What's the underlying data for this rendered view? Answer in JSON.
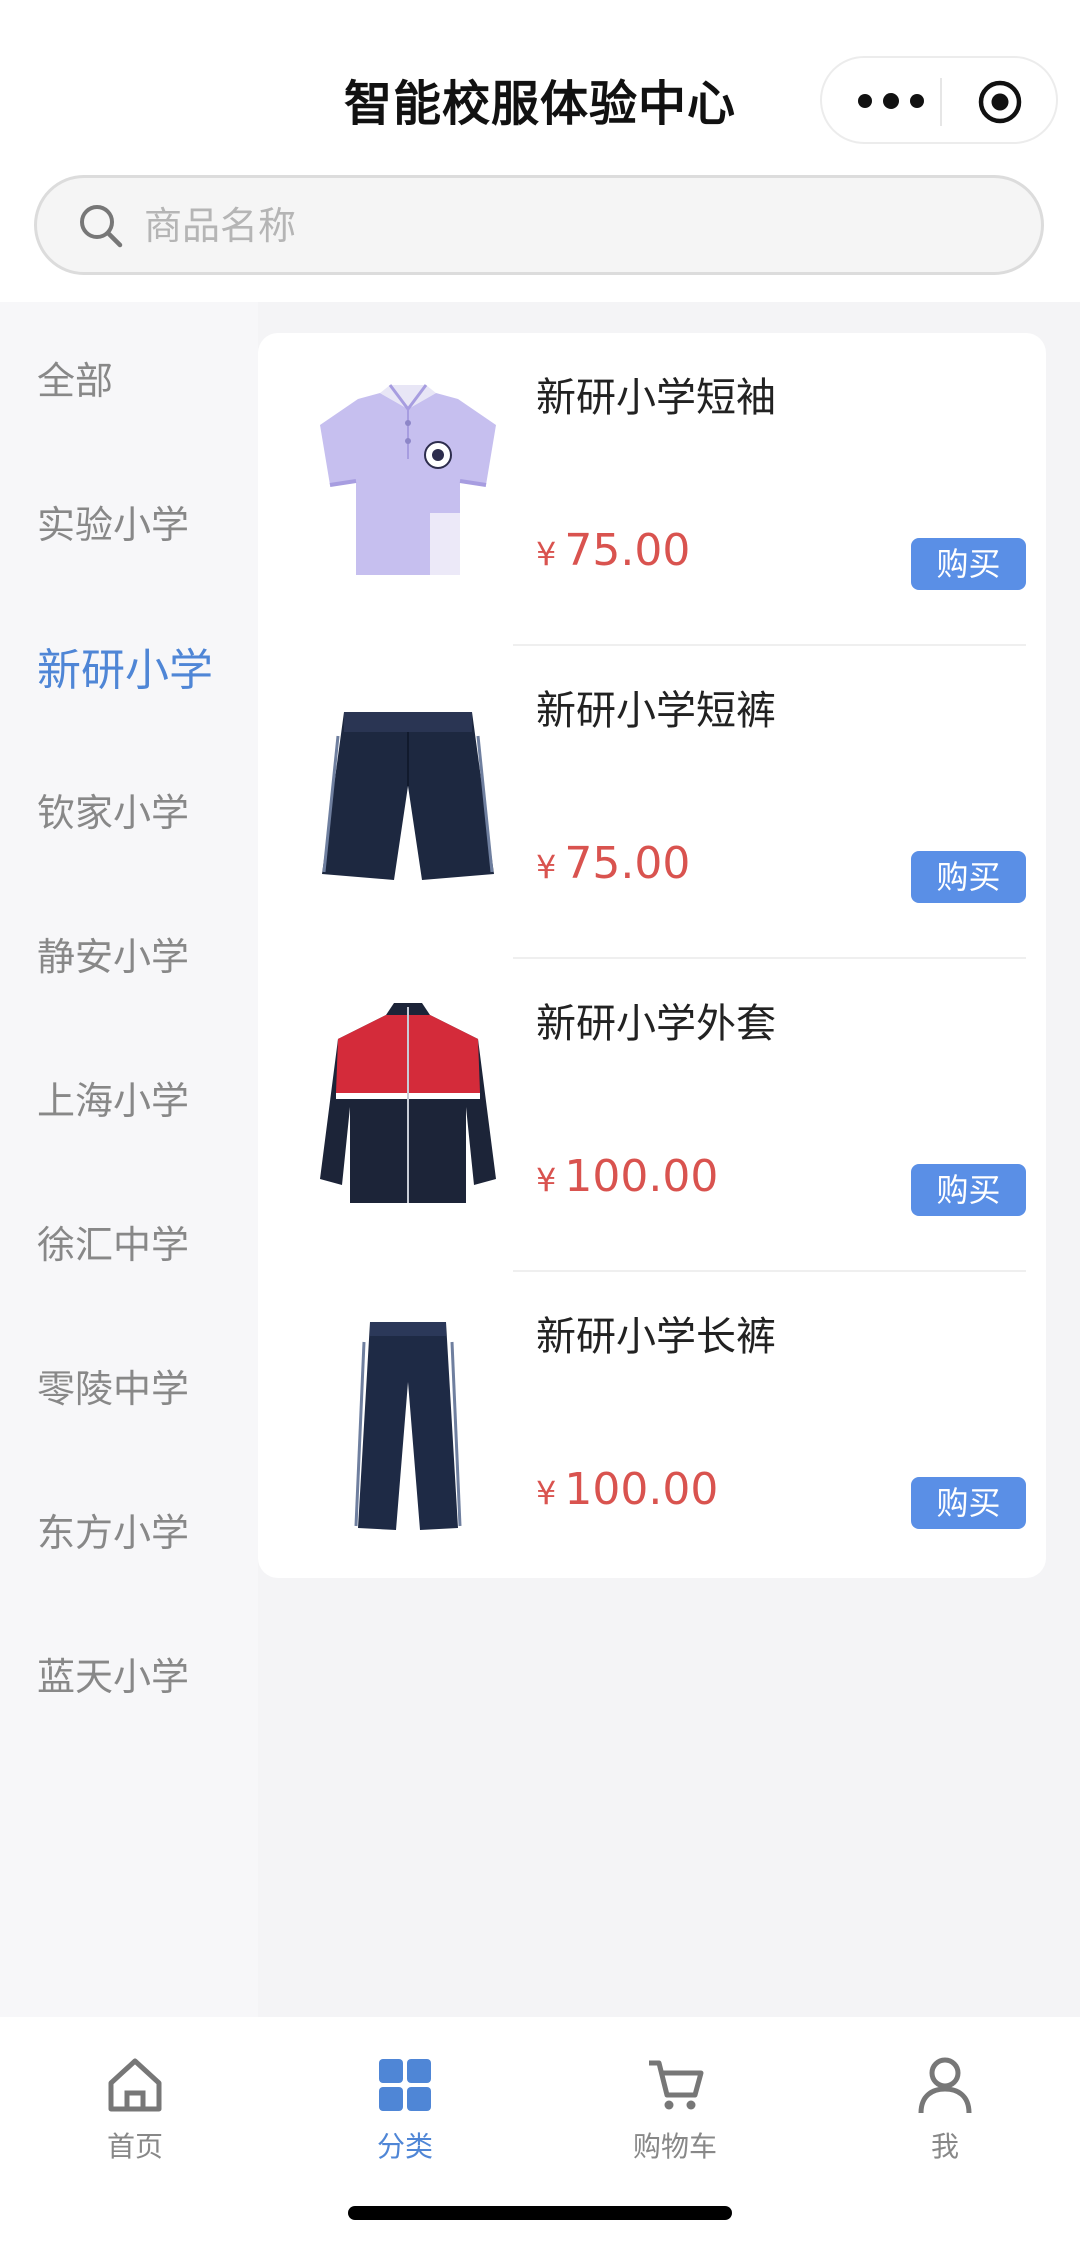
{
  "header": {
    "title": "智能校服体验中心"
  },
  "search": {
    "placeholder": "商品名称",
    "value": ""
  },
  "sidebar": {
    "items": [
      {
        "label": "全部",
        "active": false
      },
      {
        "label": "实验小学",
        "active": false
      },
      {
        "label": "新研小学",
        "active": true
      },
      {
        "label": "钦家小学",
        "active": false
      },
      {
        "label": "静安小学",
        "active": false
      },
      {
        "label": "上海小学",
        "active": false
      },
      {
        "label": "徐汇中学",
        "active": false
      },
      {
        "label": "零陵中学",
        "active": false
      },
      {
        "label": "东方小学",
        "active": false
      },
      {
        "label": "蓝天小学",
        "active": false
      }
    ]
  },
  "currency_symbol": "¥",
  "buy_label": "购买",
  "products": [
    {
      "name": "新研小学短袖",
      "price": "75.00",
      "image": "polo-shirt-image"
    },
    {
      "name": "新研小学短裤",
      "price": "75.00",
      "image": "shorts-image"
    },
    {
      "name": "新研小学外套",
      "price": "100.00",
      "image": "jacket-image"
    },
    {
      "name": "新研小学长裤",
      "price": "100.00",
      "image": "trousers-image"
    }
  ],
  "tabbar": {
    "tabs": [
      {
        "label": "首页",
        "icon": "home-icon",
        "active": false
      },
      {
        "label": "分类",
        "icon": "category-grid-icon",
        "active": true
      },
      {
        "label": "购物车",
        "icon": "cart-icon",
        "active": false
      },
      {
        "label": "我",
        "icon": "user-icon",
        "active": false
      }
    ]
  },
  "colors": {
    "accent": "#4f86d6",
    "price": "#d9534f",
    "buy_button": "#5a8fe6"
  }
}
